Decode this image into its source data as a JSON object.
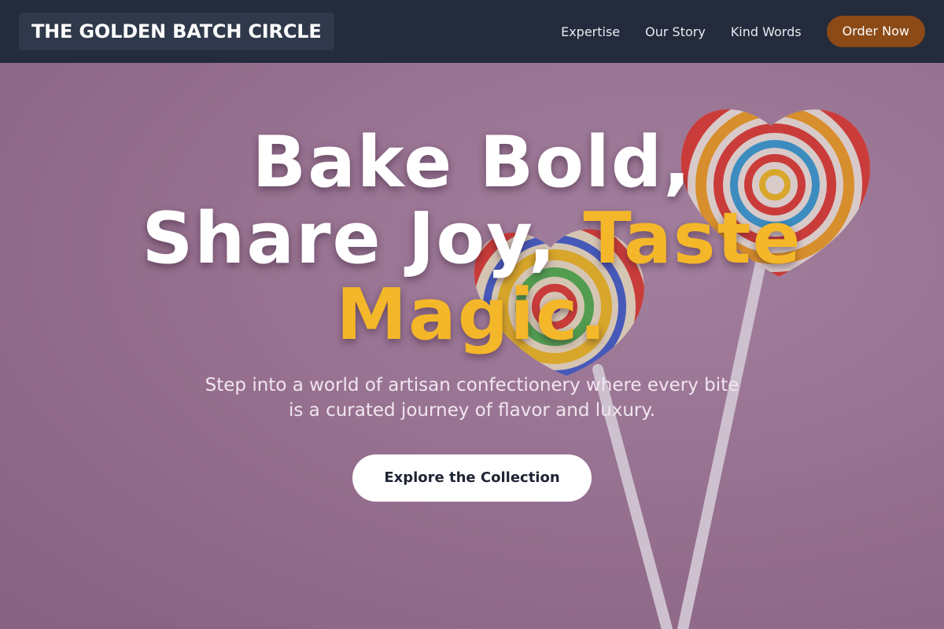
{
  "header": {
    "logo": "THE GOLDEN BATCH CIRCLE",
    "nav": [
      {
        "label": "Expertise"
      },
      {
        "label": "Our Story"
      },
      {
        "label": "Kind Words"
      }
    ],
    "cta_label": "Order Now"
  },
  "hero": {
    "title_line1": "Bake Bold,",
    "title_line2_white": "Share Joy,",
    "title_line2_accent": "Taste",
    "title_line3_accent": "Magic.",
    "subtitle": "Step into a world of artisan confectionery where every bite is a curated journey of flavor and luxury.",
    "cta_label": "Explore the Collection",
    "background_image": "heart-shaped swirl lollipops on pink background"
  },
  "colors": {
    "header_bg": "#232b3c",
    "logo_bg": "#2f394b",
    "order_button": "#8c4a16",
    "accent_gold": "#f4b729",
    "hero_bg": "#a47f9c"
  },
  "icons": [
    "lollipop-image"
  ]
}
